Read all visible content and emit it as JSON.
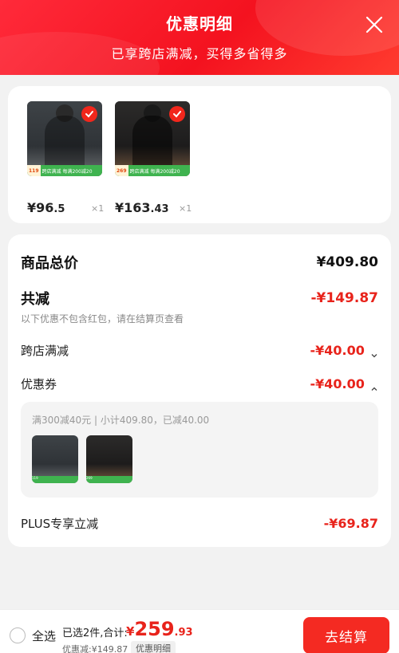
{
  "header": {
    "title": "优惠明细",
    "subtitle": "已享跨店满减，买得多省得多",
    "close_icon": "close-icon"
  },
  "products": [
    {
      "promo_price": "119",
      "promo_text": "跨店满减 每满200减20",
      "price_int": "¥96",
      "price_dec": ".5",
      "qty": "×1",
      "checked": true
    },
    {
      "promo_price": "269",
      "promo_text": "跨店满减 每满200减20",
      "price_int": "¥163",
      "price_dec": ".43",
      "qty": "×1",
      "checked": true
    }
  ],
  "summary": {
    "total_label": "商品总价",
    "total_value": "¥409.80",
    "reduce_label": "共减",
    "reduce_value": "-¥149.87",
    "reduce_note": "以下优惠不包含红包，请在结算页查看",
    "cross_store_label": "跨店满减",
    "cross_store_value": "-¥40.00",
    "coupon_label": "优惠券",
    "coupon_value": "-¥40.00",
    "coupon_detail": "满300减40元 | 小计409.80，已减40.00",
    "mini_promos": [
      "119",
      "269"
    ],
    "plus_label": "PLUS专享立减",
    "plus_value": "-¥69.87"
  },
  "footer": {
    "select_all": "全选",
    "selected_info": "已选2件,合计:",
    "total_currency": "¥",
    "total_int": "259",
    "total_dec": ".93",
    "discount_line": "优惠减:¥149.87",
    "detail_tag": "优惠明细",
    "checkout": "去结算"
  },
  "colors": {
    "brand_red": "#f42a22",
    "price_red": "#e8231b",
    "promo_green": "#3fb34f"
  }
}
